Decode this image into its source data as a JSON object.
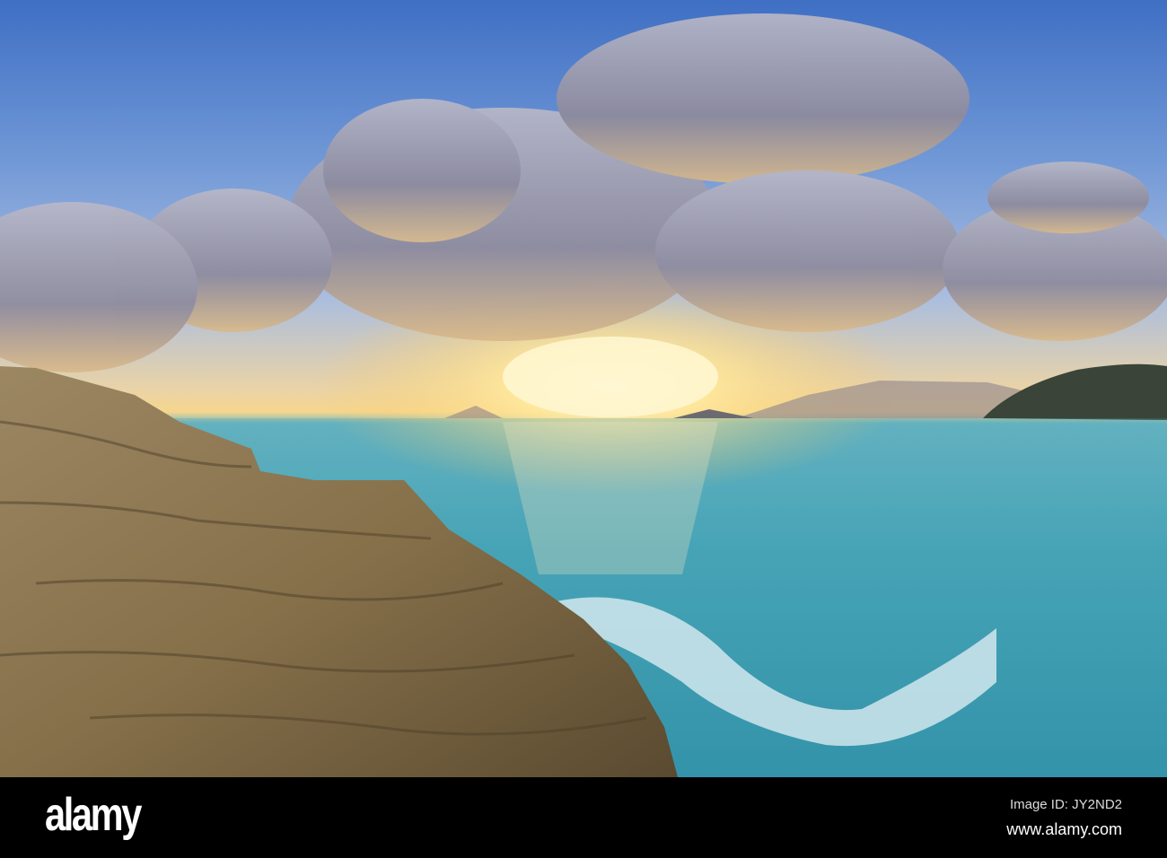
{
  "photo": {
    "subject": "Sunset over sea with rock",
    "watermark": "alamy"
  },
  "footer": {
    "logo": "alamy",
    "image_id": "Image ID: JY2ND2",
    "url": "www.alamy.com"
  },
  "colors": {
    "sky": "#5f8bd2",
    "sun": "#fff3c0",
    "sea": "#3fa0b4",
    "rock": "#8a7550",
    "footer": "#000000"
  }
}
